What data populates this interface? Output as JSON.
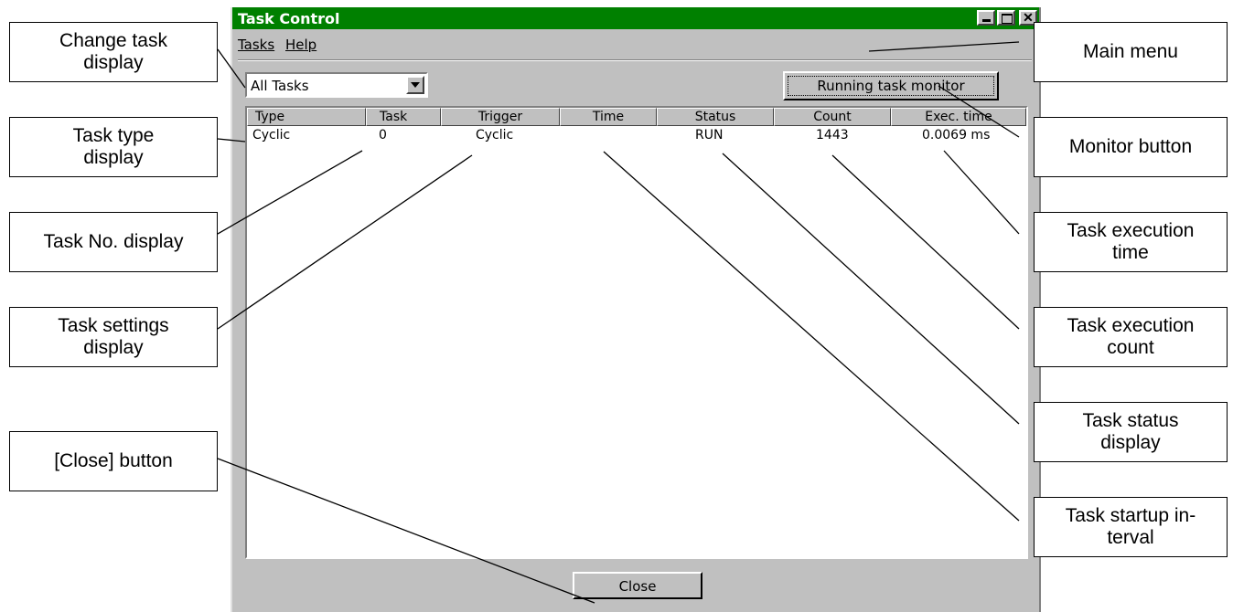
{
  "window": {
    "title": "Task Control",
    "controls": {
      "minimize": "minimize",
      "maximize": "maximize",
      "close": "✕"
    }
  },
  "menu": {
    "tasks": "Tasks",
    "help": "Help"
  },
  "filter": {
    "value": "All Tasks"
  },
  "monitor_button": "Running task monitor",
  "table": {
    "headers": [
      "Type",
      "Task",
      "Trigger",
      "Time",
      "Status",
      "Count",
      "Exec. time"
    ],
    "rows": [
      [
        "Cyclic",
        "0",
        "Cyclic",
        "",
        "RUN",
        "1443",
        "0.0069 ms"
      ]
    ]
  },
  "close_button": "Close",
  "callouts": {
    "change_task_display": "Change task\ndisplay",
    "task_type_display": "Task type\ndisplay",
    "task_no_display": "Task No. display",
    "task_settings_display": "Task settings\ndisplay",
    "close_button": "[Close] button",
    "main_menu": "Main menu",
    "monitor_button": "Monitor button",
    "task_execution_time": "Task execution\ntime",
    "task_execution_count": "Task execution\ncount",
    "task_status_display": "Task status\ndisplay",
    "task_startup_interval": "Task startup in-\nterval"
  },
  "colors": {
    "titlebar": "#008000",
    "window_face": "#c0c0c0",
    "list_background": "#ffffff"
  }
}
